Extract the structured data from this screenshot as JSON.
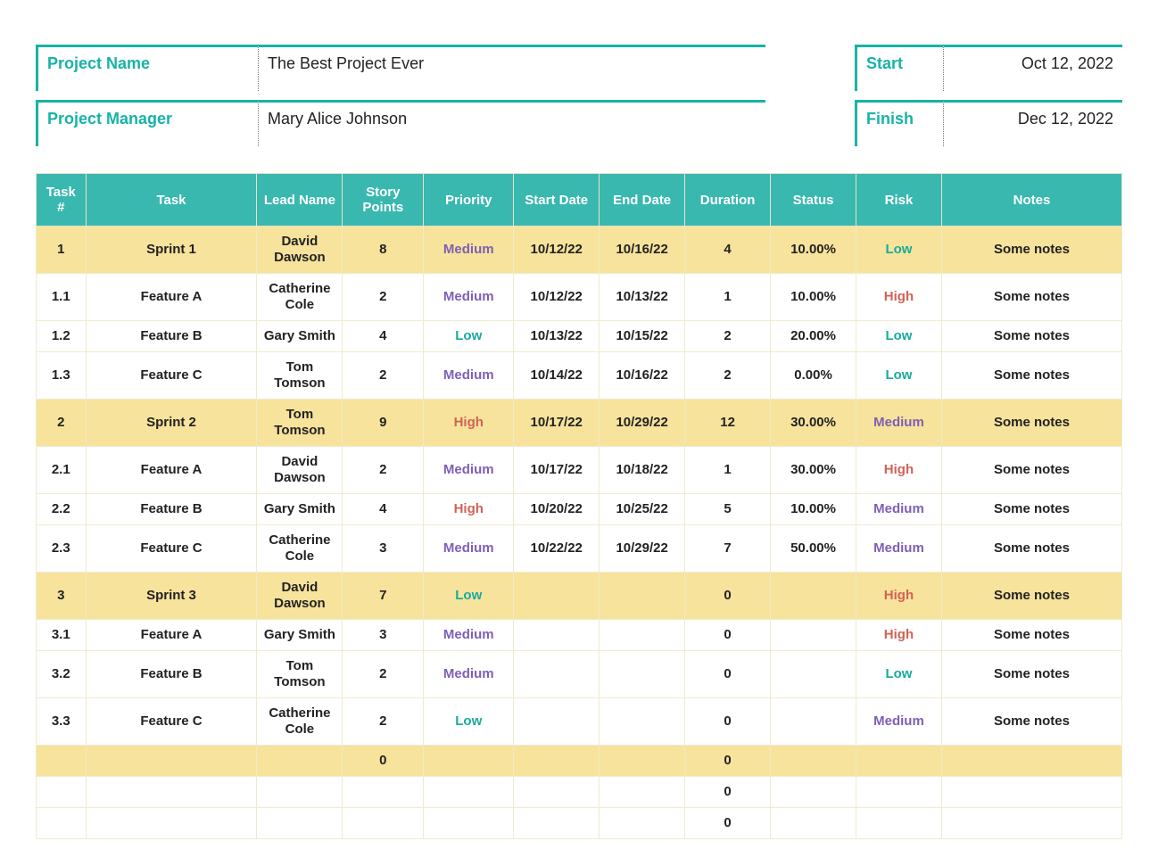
{
  "header": {
    "project_name_label": "Project Name",
    "project_name_value": "The Best Project Ever",
    "project_manager_label": "Project Manager",
    "project_manager_value": "Mary Alice Johnson",
    "start_label": "Start",
    "start_value": "Oct 12, 2022",
    "finish_label": "Finish",
    "finish_value": "Dec 12, 2022"
  },
  "columns": {
    "task_num": "Task #",
    "task": "Task",
    "lead": "Lead Name",
    "points": "Story Points",
    "priority": "Priority",
    "start": "Start Date",
    "end": "End Date",
    "duration": "Duration",
    "status": "Status",
    "risk": "Risk",
    "notes": "Notes"
  },
  "rows": [
    {
      "kind": "sprint",
      "num": "1",
      "task": "Sprint 1",
      "lead": "David Dawson",
      "points": "8",
      "priority": "Medium",
      "start": "10/12/22",
      "end": "10/16/22",
      "duration": "4",
      "status": "10.00%",
      "risk": "Low",
      "notes": "Some notes"
    },
    {
      "kind": "item",
      "num": "1.1",
      "task": "Feature A",
      "lead": "Catherine Cole",
      "points": "2",
      "priority": "Medium",
      "start": "10/12/22",
      "end": "10/13/22",
      "duration": "1",
      "status": "10.00%",
      "risk": "High",
      "notes": "Some notes"
    },
    {
      "kind": "item",
      "num": "1.2",
      "task": "Feature B",
      "lead": "Gary Smith",
      "points": "4",
      "priority": "Low",
      "start": "10/13/22",
      "end": "10/15/22",
      "duration": "2",
      "status": "20.00%",
      "risk": "Low",
      "notes": "Some notes"
    },
    {
      "kind": "item",
      "num": "1.3",
      "task": "Feature C",
      "lead": "Tom Tomson",
      "points": "2",
      "priority": "Medium",
      "start": "10/14/22",
      "end": "10/16/22",
      "duration": "2",
      "status": "0.00%",
      "risk": "Low",
      "notes": "Some notes"
    },
    {
      "kind": "sprint",
      "num": "2",
      "task": "Sprint 2",
      "lead": "Tom Tomson",
      "points": "9",
      "priority": "High",
      "start": "10/17/22",
      "end": "10/29/22",
      "duration": "12",
      "status": "30.00%",
      "risk": "Medium",
      "notes": "Some notes"
    },
    {
      "kind": "item",
      "num": "2.1",
      "task": "Feature A",
      "lead": "David Dawson",
      "points": "2",
      "priority": "Medium",
      "start": "10/17/22",
      "end": "10/18/22",
      "duration": "1",
      "status": "30.00%",
      "risk": "High",
      "notes": "Some notes"
    },
    {
      "kind": "item",
      "num": "2.2",
      "task": "Feature B",
      "lead": "Gary Smith",
      "points": "4",
      "priority": "High",
      "start": "10/20/22",
      "end": "10/25/22",
      "duration": "5",
      "status": "10.00%",
      "risk": "Medium",
      "notes": "Some notes"
    },
    {
      "kind": "item",
      "num": "2.3",
      "task": "Feature C",
      "lead": "Catherine Cole",
      "points": "3",
      "priority": "Medium",
      "start": "10/22/22",
      "end": "10/29/22",
      "duration": "7",
      "status": "50.00%",
      "risk": "Medium",
      "notes": "Some notes"
    },
    {
      "kind": "sprint",
      "num": "3",
      "task": "Sprint 3",
      "lead": "David Dawson",
      "points": "7",
      "priority": "Low",
      "start": "",
      "end": "",
      "duration": "0",
      "status": "",
      "risk": "High",
      "notes": "Some notes"
    },
    {
      "kind": "item",
      "num": "3.1",
      "task": "Feature A",
      "lead": "Gary Smith",
      "points": "3",
      "priority": "Medium",
      "start": "",
      "end": "",
      "duration": "0",
      "status": "",
      "risk": "High",
      "notes": "Some notes"
    },
    {
      "kind": "item",
      "num": "3.2",
      "task": "Feature B",
      "lead": "Tom Tomson",
      "points": "2",
      "priority": "Medium",
      "start": "",
      "end": "",
      "duration": "0",
      "status": "",
      "risk": "Low",
      "notes": "Some notes"
    },
    {
      "kind": "item",
      "num": "3.3",
      "task": "Feature C",
      "lead": "Catherine Cole",
      "points": "2",
      "priority": "Low",
      "start": "",
      "end": "",
      "duration": "0",
      "status": "",
      "risk": "Medium",
      "notes": "Some notes"
    },
    {
      "kind": "empty-sprint",
      "num": "",
      "task": "",
      "lead": "",
      "points": "0",
      "priority": "",
      "start": "",
      "end": "",
      "duration": "0",
      "status": "",
      "risk": "",
      "notes": ""
    },
    {
      "kind": "empty",
      "num": "",
      "task": "",
      "lead": "",
      "points": "",
      "priority": "",
      "start": "",
      "end": "",
      "duration": "0",
      "status": "",
      "risk": "",
      "notes": ""
    },
    {
      "kind": "empty",
      "num": "",
      "task": "",
      "lead": "",
      "points": "",
      "priority": "",
      "start": "",
      "end": "",
      "duration": "0",
      "status": "",
      "risk": "",
      "notes": ""
    }
  ]
}
